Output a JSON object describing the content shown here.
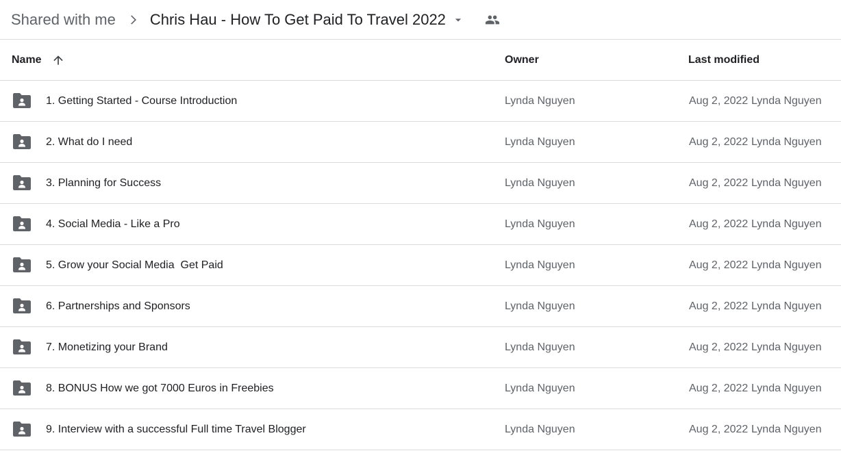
{
  "breadcrumb": {
    "root": "Shared with me",
    "current": "Chris Hau - How To Get Paid To Travel 2022"
  },
  "columns": {
    "name": "Name",
    "owner": "Owner",
    "last_modified": "Last modified"
  },
  "icons": {
    "breadcrumb_separator": "chevron-right-icon",
    "dropdown": "arrow-drop-down-icon",
    "shared": "shared-people-icon",
    "sort": "arrow-upward-icon",
    "folder": "shared-folder-icon"
  },
  "colors": {
    "icon": "#5f6368",
    "divider": "#dadce0",
    "text_primary": "#202124",
    "text_secondary": "#5f6368"
  },
  "rows": [
    {
      "name": "1. Getting Started - Course Introduction",
      "owner": "Lynda Nguyen",
      "modified_date": "Aug 2, 2022",
      "modified_by": "Lynda Nguyen"
    },
    {
      "name": "2. What do I need",
      "owner": "Lynda Nguyen",
      "modified_date": "Aug 2, 2022",
      "modified_by": "Lynda Nguyen"
    },
    {
      "name": "3. Planning for Success",
      "owner": "Lynda Nguyen",
      "modified_date": "Aug 2, 2022",
      "modified_by": "Lynda Nguyen"
    },
    {
      "name": "4. Social Media - Like a Pro",
      "owner": "Lynda Nguyen",
      "modified_date": "Aug 2, 2022",
      "modified_by": "Lynda Nguyen"
    },
    {
      "name": "5. Grow your Social Media  Get Paid",
      "owner": "Lynda Nguyen",
      "modified_date": "Aug 2, 2022",
      "modified_by": "Lynda Nguyen"
    },
    {
      "name": "6. Partnerships and Sponsors",
      "owner": "Lynda Nguyen",
      "modified_date": "Aug 2, 2022",
      "modified_by": "Lynda Nguyen"
    },
    {
      "name": "7. Monetizing your Brand",
      "owner": "Lynda Nguyen",
      "modified_date": "Aug 2, 2022",
      "modified_by": "Lynda Nguyen"
    },
    {
      "name": "8. BONUS How we got 7000 Euros in Freebies",
      "owner": "Lynda Nguyen",
      "modified_date": "Aug 2, 2022",
      "modified_by": "Lynda Nguyen"
    },
    {
      "name": "9. Interview with a successful Full time Travel Blogger",
      "owner": "Lynda Nguyen",
      "modified_date": "Aug 2, 2022",
      "modified_by": "Lynda Nguyen"
    }
  ]
}
